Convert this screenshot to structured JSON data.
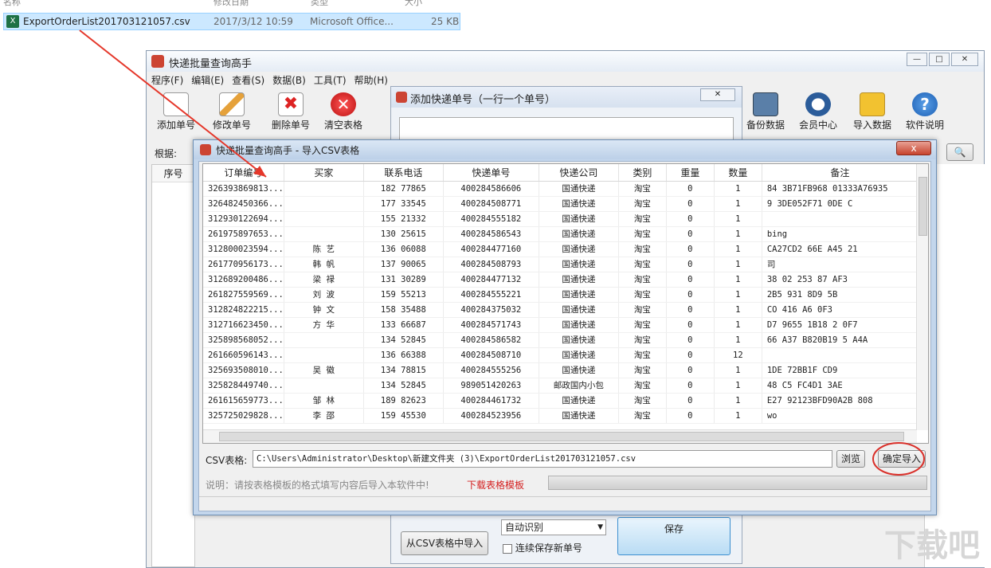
{
  "explorer": {
    "header_fragments": [
      "名称",
      "修改日期",
      "类型",
      "大小"
    ],
    "file": {
      "name": "ExportOrderList201703121057.csv",
      "modified": "2017/3/12 10:59",
      "type": "Microsoft Office...",
      "size": "25 KB"
    }
  },
  "main_window": {
    "title": "快递批量查询高手",
    "menu": [
      "程序(F)",
      "编辑(E)",
      "查看(S)",
      "数据(B)",
      "工具(T)",
      "帮助(H)"
    ],
    "toolbar_left": [
      "添加单号",
      "修改单号",
      "删除单号",
      "清空表格"
    ],
    "toolbar_right": [
      "备份数据",
      "会员中心",
      "导入数据",
      "软件说明"
    ],
    "basis_label": "根据:",
    "grid_header": "序号"
  },
  "add_dialog": {
    "title": "添加快递单号（一行一个单号）",
    "mode_select": "自动识别",
    "save_button": "保存",
    "import_csv_button": "从CSV表格中导入",
    "continuous_save_label": "连续保存新单号"
  },
  "csv_dialog": {
    "title": "快递批量查询高手 - 导入CSV表格",
    "close_label": "x",
    "columns": [
      "订单编号",
      "买家",
      "联系电话",
      "快递单号",
      "快递公司",
      "类别",
      "重量",
      "数量",
      "备注"
    ],
    "rows": [
      [
        "326393869813...",
        "",
        "182  77865",
        "400284586606",
        "国通快递",
        "淘宝",
        "0",
        "1",
        "84  3B71FB968  01333A76935"
      ],
      [
        "326482450366...",
        "",
        "177  33545",
        "400284508771",
        "国通快递",
        "淘宝",
        "0",
        "1",
        "9  3DE052F71  0DE  C"
      ],
      [
        "312930122694...",
        "",
        "155  21332",
        "400284555182",
        "国通快递",
        "淘宝",
        "0",
        "1",
        ""
      ],
      [
        "261975897653...",
        "",
        "130  25615",
        "400284586543",
        "国通快递",
        "淘宝",
        "0",
        "1",
        "  bing"
      ],
      [
        "312800023594...",
        "陈  艺",
        "136  06088",
        "400284477160",
        "国通快递",
        "淘宝",
        "0",
        "1",
        "  CA27CD2  66E  A45  21"
      ],
      [
        "261770956173...",
        "韩  帆",
        "137  90065",
        "400284508793",
        "国通快递",
        "淘宝",
        "0",
        "1",
        "  司"
      ],
      [
        "312689200486...",
        "梁  禄",
        "131  30289",
        "400284477132",
        "国通快递",
        "淘宝",
        "0",
        "1",
        "  38  02  253  87  AF3"
      ],
      [
        "261827559569...",
        "刘  波",
        "159  55213",
        "400284555221",
        "国通快递",
        "淘宝",
        "0",
        "1",
        "  2B5  931  8D9  5B"
      ],
      [
        "312824822215...",
        "钟  文",
        "158  35488",
        "400284375032",
        "国通快递",
        "淘宝",
        "0",
        "1",
        "  CO  416  A6  0F3"
      ],
      [
        "312716623450...",
        "方  华",
        "133  66687",
        "400284571743",
        "国通快递",
        "淘宝",
        "0",
        "1",
        "  D7  9655  1B18  2  0F7"
      ],
      [
        "325898568052...",
        "",
        "134  52845",
        "400284586582",
        "国通快递",
        "淘宝",
        "0",
        "1",
        "  66  A37  B820B19  5  A4A"
      ],
      [
        "261660596143...",
        "",
        "136  66388",
        "400284508710",
        "国通快递",
        "淘宝",
        "0",
        "12",
        ""
      ],
      [
        "325693508010...",
        "吴  徽",
        "134  78815",
        "400284555256",
        "国通快递",
        "淘宝",
        "0",
        "1",
        "  1DE  72BB1F  CD9"
      ],
      [
        "325828449740...",
        "",
        "134  52845",
        "989051420263",
        "邮政国内小包",
        "淘宝",
        "0",
        "1",
        "48  C5  FC4D1  3AE"
      ],
      [
        "261615659773...",
        "邹  林",
        "189  82623",
        "400284461732",
        "国通快递",
        "淘宝",
        "0",
        "1",
        "E27  92123BFD90A2B  808"
      ],
      [
        "325725029828...",
        "李  邵",
        "159  45530",
        "400284523956",
        "国通快递",
        "淘宝",
        "0",
        "1",
        "wo"
      ]
    ],
    "csv_label": "CSV表格:",
    "csv_path": "C:\\Users\\Administrator\\Desktop\\新建文件夹 (3)\\ExportOrderList201703121057.csv",
    "browse_button": "浏览",
    "confirm_button": "确定导入",
    "note": "说明：请按表格模板的格式填写内容后导入本软件中!",
    "download_link": "下载表格模板"
  },
  "watermark": "下载吧",
  "colors": {
    "arrow": "#e5372a",
    "highlight_circle": "#d9302a",
    "link_red": "#d42020",
    "titlebar": "#bcd0e8"
  }
}
